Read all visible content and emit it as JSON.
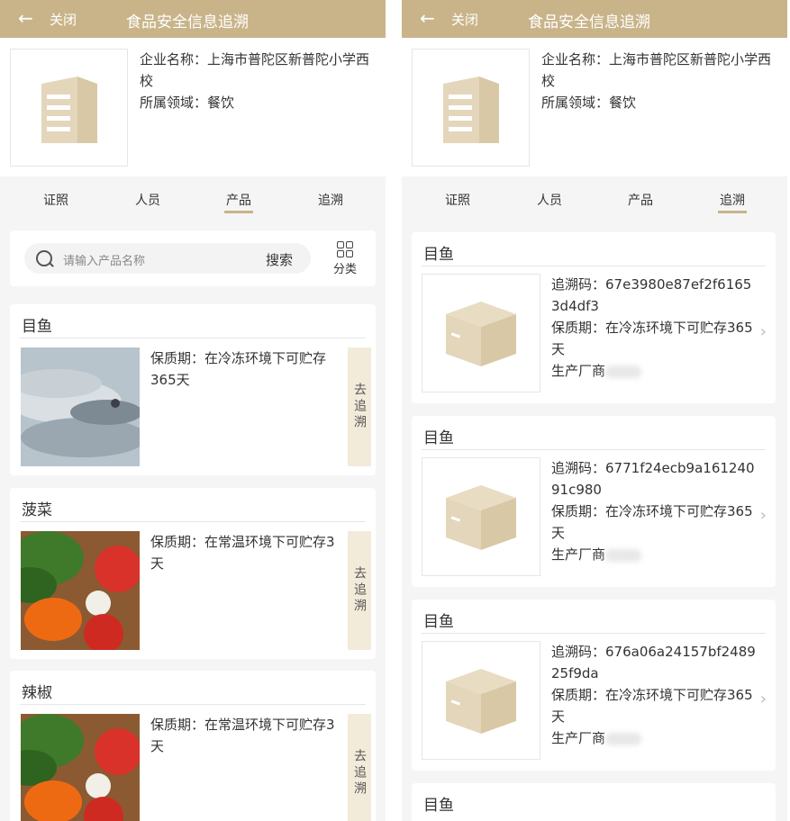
{
  "header": {
    "close_label": "关闭",
    "title": "食品安全信息追溯"
  },
  "enterprise": {
    "name_label": "企业名称：",
    "name": "上海市普陀区新普陀小学西校",
    "domain_label": "所属领域：",
    "domain": "餐饮"
  },
  "tabs": [
    "证照",
    "人员",
    "产品",
    "追溯"
  ],
  "left": {
    "active_tab": "产品",
    "search": {
      "placeholder": "请输入产品名称",
      "button": "搜索",
      "category": "分类"
    },
    "products": [
      {
        "name": "目鱼",
        "shelf_label": "保质期：",
        "shelf": "在冷冻环境下可贮存365天",
        "trace_button": "去追溯"
      },
      {
        "name": "菠菜",
        "shelf_label": "保质期：",
        "shelf": "在常温环境下可贮存3天",
        "trace_button": "去追溯"
      },
      {
        "name": "辣椒",
        "shelf_label": "保质期：",
        "shelf": "在常温环境下可贮存3天",
        "trace_button": "去追溯"
      }
    ]
  },
  "right": {
    "active_tab": "追溯",
    "records": [
      {
        "name": "目鱼",
        "code_label": "追溯码：",
        "code": "67e3980e87ef2f61653d4df3",
        "shelf_label": "保质期：",
        "shelf": "在冷冻环境下可贮存365天",
        "maker_label": "生产厂商"
      },
      {
        "name": "目鱼",
        "code_label": "追溯码：",
        "code": "6771f24ecb9a16124091c980",
        "shelf_label": "保质期：",
        "shelf": "在冷冻环境下可贮存365天",
        "maker_label": "生产厂商"
      },
      {
        "name": "目鱼",
        "code_label": "追溯码：",
        "code": "676a06a24157bf248925f9da",
        "shelf_label": "保质期：",
        "shelf": "在冷冻环境下可贮存365天",
        "maker_label": "生产厂商"
      },
      {
        "name": "目鱼"
      }
    ]
  },
  "colors": {
    "brand": "#c9b48a",
    "trace_bg": "#f3ebda",
    "icon": "#e3d6bb"
  },
  "icons": [
    "back-arrow-icon",
    "building-icon",
    "search-icon",
    "category-grid-icon",
    "box-icon",
    "chevron-right-icon"
  ]
}
